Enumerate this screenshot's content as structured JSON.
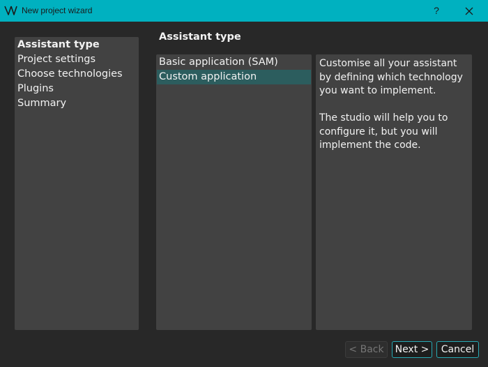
{
  "window": {
    "title": "New project wizard",
    "help_label": "?",
    "accent_color": "#00b1c0"
  },
  "nav": {
    "items": [
      {
        "label": "Assistant type",
        "active": true
      },
      {
        "label": "Project settings",
        "active": false
      },
      {
        "label": "Choose technologies",
        "active": false
      },
      {
        "label": "Plugins",
        "active": false
      },
      {
        "label": "Summary",
        "active": false
      }
    ]
  },
  "main": {
    "section_title": "Assistant type",
    "options": [
      {
        "label": "Basic application (SAM)",
        "selected": false
      },
      {
        "label": "Custom application",
        "selected": true
      }
    ],
    "description": {
      "paragraph1": "Customise all your assistant by defining which technology you want to implement.",
      "paragraph2": "The studio will help you to configure it, but you will implement the code."
    }
  },
  "footer": {
    "back_label": "< Back",
    "back_enabled": false,
    "next_label": "Next >",
    "cancel_label": "Cancel"
  },
  "icons": {
    "app_logo": "app-logo-icon",
    "close": "close-icon"
  },
  "colors": {
    "selection": "#2c5d5e",
    "panel": "#424242",
    "background": "#282828"
  }
}
